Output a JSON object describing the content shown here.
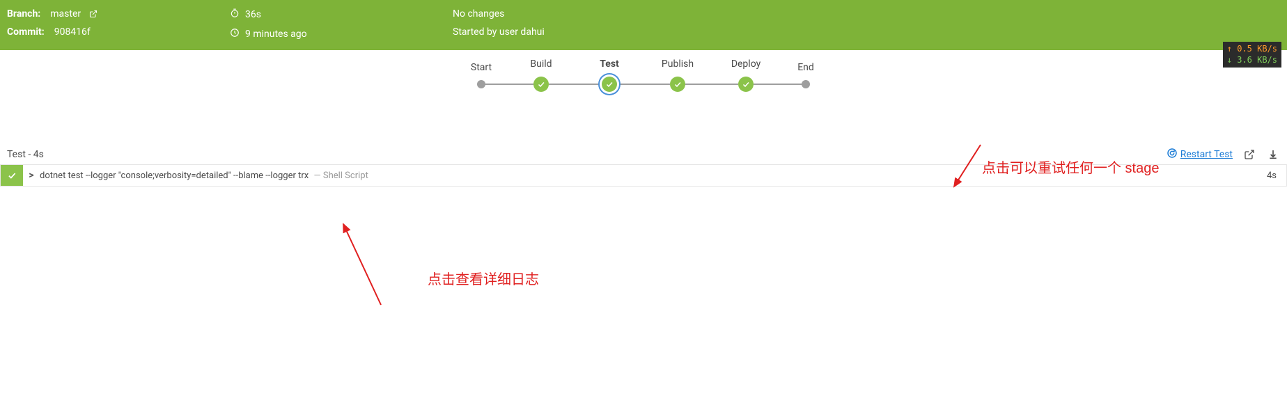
{
  "header": {
    "branch_label": "Branch:",
    "branch_value": "master",
    "commit_label": "Commit:",
    "commit_value": "908416f",
    "duration": "36s",
    "age": "9 minutes ago",
    "changes": "No changes",
    "started_by": "Started by user dahui"
  },
  "network": {
    "up": "↑ 0.5 KB/s",
    "down": "↓ 3.6 KB/s"
  },
  "pipeline": {
    "stages": [
      {
        "label": "Start",
        "type": "small",
        "active": false
      },
      {
        "label": "Build",
        "type": "check",
        "active": false
      },
      {
        "label": "Test",
        "type": "check",
        "active": true
      },
      {
        "label": "Publish",
        "type": "check",
        "active": false
      },
      {
        "label": "Deploy",
        "type": "check",
        "active": false
      },
      {
        "label": "End",
        "type": "small",
        "active": false
      }
    ]
  },
  "annotations": {
    "restart_hint": "点击可以重试任何一个 stage",
    "log_hint": "点击查看详细日志"
  },
  "section": {
    "title": "Test - 4s",
    "restart_label": "Restart Test"
  },
  "step": {
    "chevron": ">",
    "command": "dotnet test --logger \"console;verbosity=detailed\" --blame --logger trx",
    "hint_prefix": "—",
    "hint": "Shell Script",
    "duration": "4s"
  }
}
